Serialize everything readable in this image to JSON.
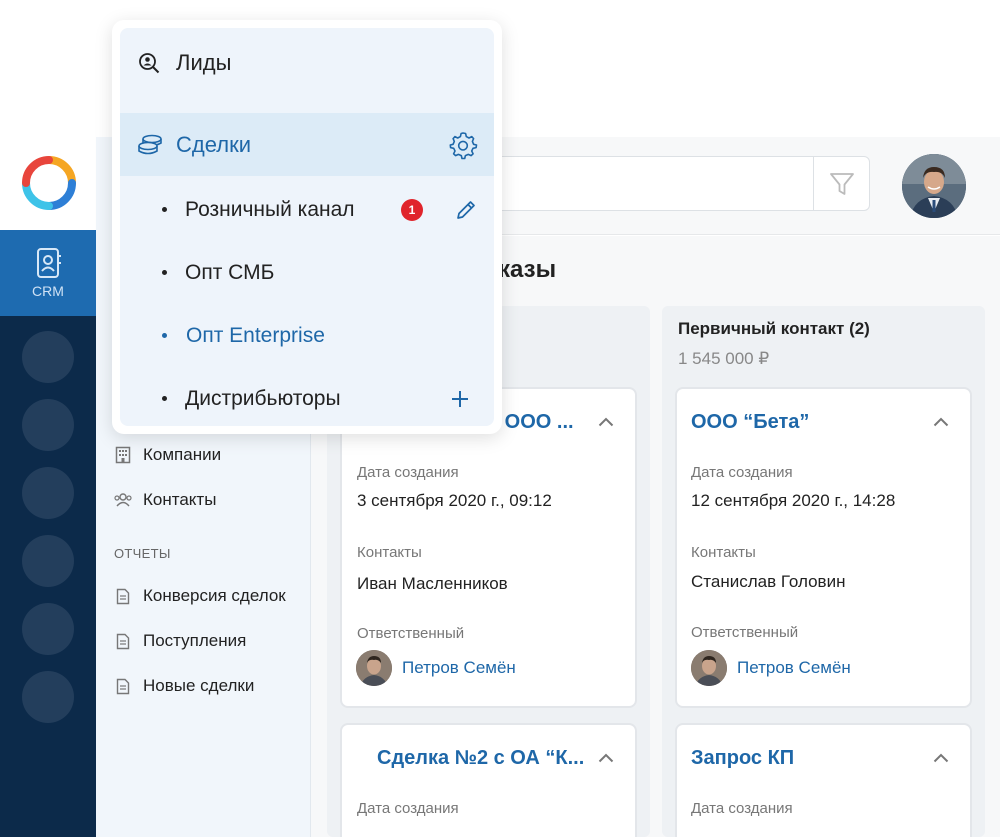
{
  "sidebar": {
    "crm_label": "CRM",
    "items": [
      {
        "label": "Компании",
        "icon": "building-icon"
      },
      {
        "label": "Контакты",
        "icon": "people-icon"
      }
    ],
    "reports_section": "ОТЧЕТЫ",
    "reports": [
      {
        "label": "Конверсия сделок",
        "icon": "document-icon"
      },
      {
        "label": "Поступления",
        "icon": "document-icon"
      },
      {
        "label": "Новые сделки",
        "icon": "document-icon"
      }
    ]
  },
  "header": {
    "search_placeholder": "",
    "filter_icon": "filter-icon"
  },
  "board": {
    "title_visible": "казы",
    "columns": [
      {
        "title": "",
        "sum": "",
        "cards": [
          {
            "title": "с ООО ...",
            "created_label": "Дата создания",
            "created": "3 сентября 2020 г., 09:12",
            "contacts_label": "Контакты",
            "contact": "Иван Масленников",
            "owner_label": "Ответственный",
            "owner": "Петров Семён"
          },
          {
            "title": "Сделка №2 с ОА “К...",
            "created_label": "Дата создания"
          }
        ]
      },
      {
        "title": "Первичный контакт (2)",
        "sum": "1 545 000 ₽",
        "cards": [
          {
            "title": "ООО “Бета”",
            "created_label": "Дата создания",
            "created": "12 сентября 2020 г., 14:28",
            "contacts_label": "Контакты",
            "contact": "Станислав Головин",
            "owner_label": "Ответственный",
            "owner": "Петров Семён"
          },
          {
            "title": "Запрос КП",
            "created_label": "Дата создания"
          }
        ]
      }
    ]
  },
  "dropdown": {
    "leads": "Лиды",
    "deals": "Сделки",
    "pipelines": [
      {
        "label": "Розничный канал",
        "badge": "1"
      },
      {
        "label": "Опт СМБ"
      },
      {
        "label": "Опт Enterprise"
      },
      {
        "label": "Дистрибьюторы"
      }
    ]
  },
  "colors": {
    "accent": "#1e67a8",
    "rail": "#0c2a4a",
    "badge": "#e0242b"
  }
}
